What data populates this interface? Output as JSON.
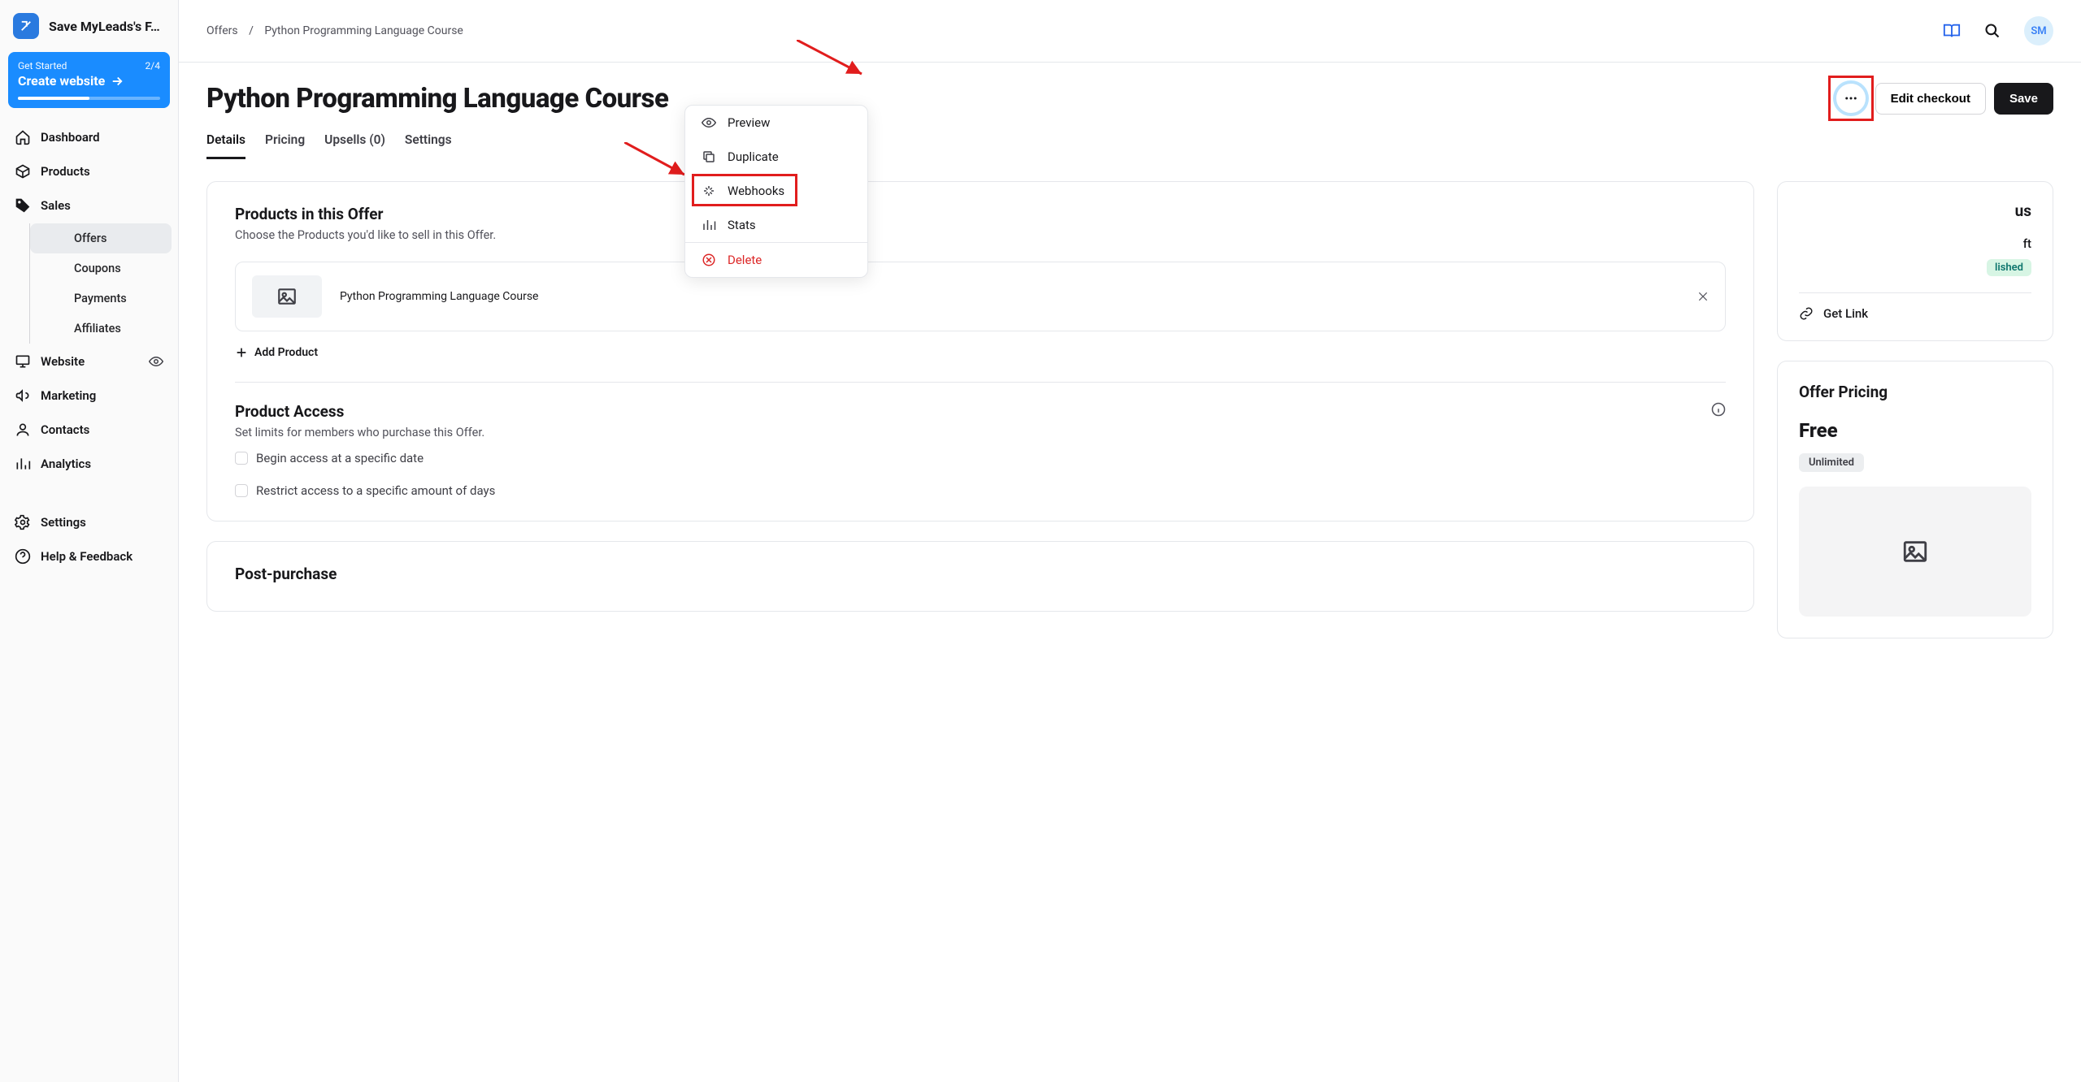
{
  "brand": {
    "name": "Save MyLeads's F…"
  },
  "getStarted": {
    "label": "Get Started",
    "progress_text": "2/4",
    "title": "Create website"
  },
  "nav": {
    "dashboard": "Dashboard",
    "products": "Products",
    "sales": "Sales",
    "sales_sub": {
      "offers": "Offers",
      "coupons": "Coupons",
      "payments": "Payments",
      "affiliates": "Affiliates"
    },
    "website": "Website",
    "marketing": "Marketing",
    "contacts": "Contacts",
    "analytics": "Analytics",
    "settings": "Settings",
    "help": "Help & Feedback"
  },
  "breadcrumb": {
    "root": "Offers",
    "sep": "/",
    "current": "Python Programming Language Course"
  },
  "header_icons": {
    "avatar": "SM"
  },
  "page": {
    "title": "Python Programming Language Course"
  },
  "actions": {
    "edit_checkout": "Edit checkout",
    "save": "Save"
  },
  "tabs": {
    "details": "Details",
    "pricing": "Pricing",
    "upsells": "Upsells (0)",
    "settings": "Settings"
  },
  "menu": {
    "preview": "Preview",
    "duplicate": "Duplicate",
    "webhooks": "Webhooks",
    "stats": "Stats",
    "delete": "Delete"
  },
  "products_card": {
    "title": "Products in this Offer",
    "subtitle": "Choose the Products you'd like to sell in this Offer.",
    "item_name": "Python Programming Language Course",
    "add": "Add Product"
  },
  "access_card": {
    "title": "Product Access",
    "subtitle": "Set limits for members who purchase this Offer.",
    "check1": "Begin access at a specific date",
    "check2": "Restrict access to a specific amount of days"
  },
  "post_purchase": {
    "title": "Post-purchase"
  },
  "status_card": {
    "title_partial": "us",
    "draft_partial": "ft",
    "published_partial": "lished",
    "get_link": "Get Link"
  },
  "pricing_card": {
    "title": "Offer Pricing",
    "price": "Free",
    "chip": "Unlimited"
  }
}
